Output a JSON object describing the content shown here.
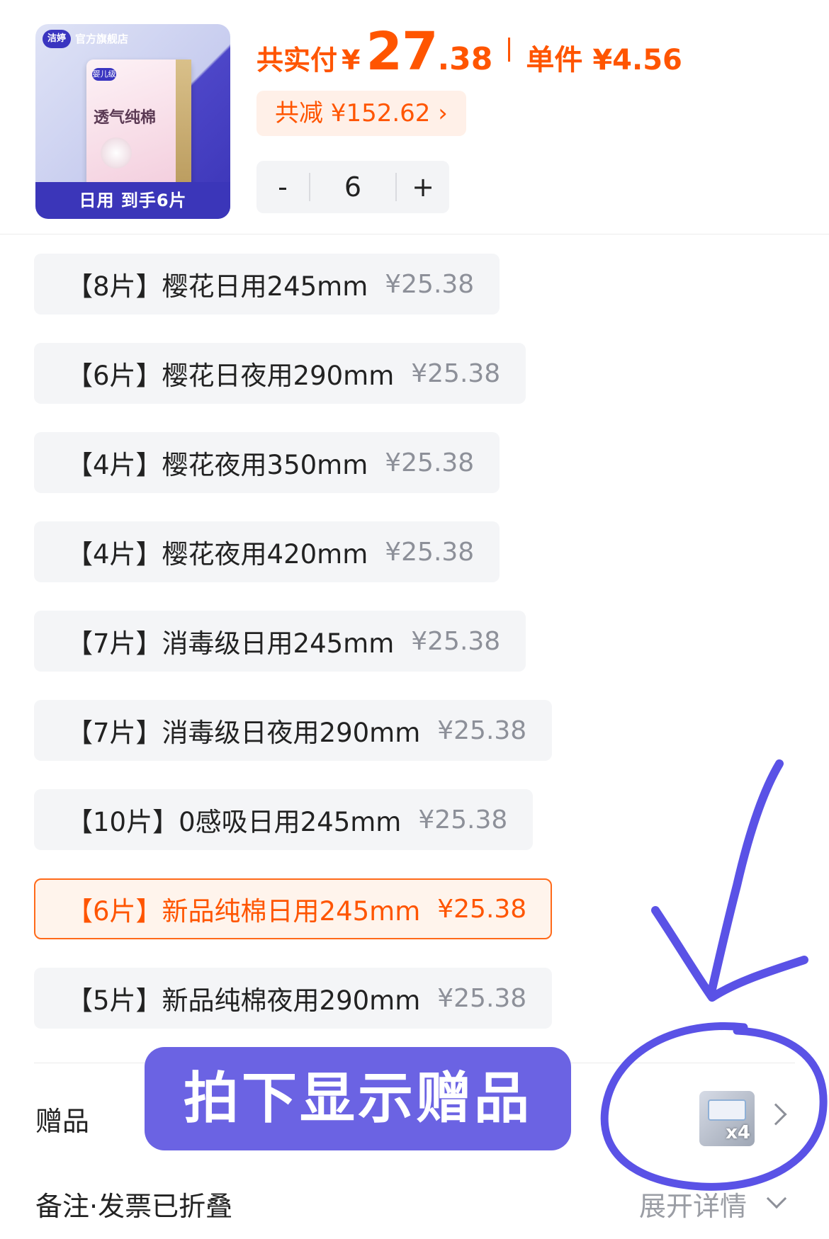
{
  "product": {
    "image": {
      "brand_logo": "洁婷",
      "store_name": "官方旗舰店",
      "badge": "婴儿级",
      "pack_title": "透气纯棉",
      "caption": "日用 到手6片"
    }
  },
  "price": {
    "total_label": "共实付",
    "currency": "¥",
    "total_int": "27",
    "total_dec": ".38",
    "unit_text": "单件 ¥4.56"
  },
  "discount": {
    "text": "共减 ¥152.62 ›"
  },
  "quantity": {
    "minus": "-",
    "value": "6",
    "plus": "+"
  },
  "options": [
    {
      "name": "【8片】樱花日用245mm",
      "price": "¥25.38",
      "selected": false
    },
    {
      "name": "【6片】樱花日夜用290mm",
      "price": "¥25.38",
      "selected": false
    },
    {
      "name": "【4片】樱花夜用350mm",
      "price": "¥25.38",
      "selected": false
    },
    {
      "name": "【4片】樱花夜用420mm",
      "price": "¥25.38",
      "selected": false
    },
    {
      "name": "【7片】消毒级日用245mm",
      "price": "¥25.38",
      "selected": false
    },
    {
      "name": "【7片】消毒级日夜用290mm",
      "price": "¥25.38",
      "selected": false
    },
    {
      "name": "【10片】0感吸日用245mm",
      "price": "¥25.38",
      "selected": false
    },
    {
      "name": "【6片】新品纯棉日用245mm",
      "price": "¥25.38",
      "selected": true
    },
    {
      "name": "【5片】新品纯棉夜用290mm",
      "price": "¥25.38",
      "selected": false
    }
  ],
  "gift": {
    "label": "赠品",
    "banner": "拍下显示赠品",
    "count": "x4",
    "chevron_icon": "chevron-right-icon"
  },
  "remarks": {
    "label": "备注·发票已折叠",
    "expand": "展开详情",
    "chevron_icon": "chevron-down-icon"
  },
  "colors": {
    "accent": "#ff5500",
    "banner": "#6b63e3",
    "annotation": "#5a52e6"
  }
}
